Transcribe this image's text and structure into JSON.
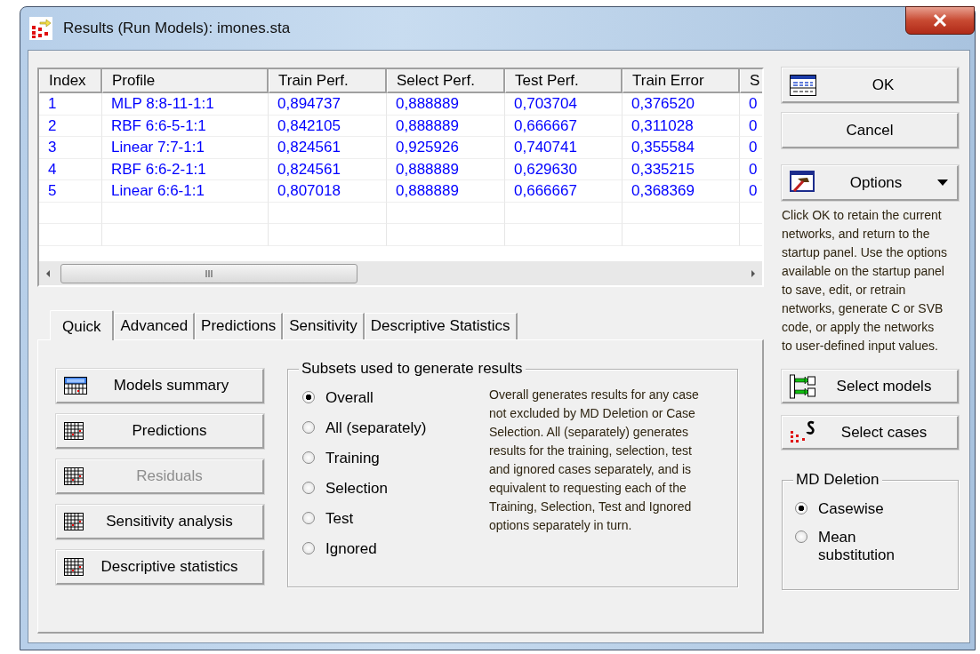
{
  "window": {
    "title": "Results (Run Models): imones.sta"
  },
  "table": {
    "columns": [
      "Index",
      "Profile",
      "Train Perf.",
      "Select Perf.",
      "Test Perf.",
      "Train Error",
      "S"
    ],
    "rows": [
      {
        "cells": [
          "1",
          "MLP 8:8-11-1:1",
          "0,894737",
          "0,888889",
          "0,703704",
          "0,376520",
          "0"
        ]
      },
      {
        "cells": [
          "2",
          "RBF 6:6-5-1:1",
          "0,842105",
          "0,888889",
          "0,666667",
          "0,311028",
          "0"
        ]
      },
      {
        "cells": [
          "3",
          "Linear 7:7-1:1",
          "0,824561",
          "0,925926",
          "0,740741",
          "0,355584",
          "0"
        ]
      },
      {
        "cells": [
          "4",
          "RBF 6:6-2-1:1",
          "0,824561",
          "0,888889",
          "0,629630",
          "0,335215",
          "0"
        ]
      },
      {
        "cells": [
          "5",
          "Linear 6:6-1:1",
          "0,807018",
          "0,888889",
          "0,666667",
          "0,368369",
          "0"
        ]
      }
    ]
  },
  "buttons": [
    {
      "label": "OK",
      "kind": "ok"
    },
    {
      "label": "Cancel",
      "kind": "plain"
    },
    {
      "label": "Options",
      "kind": "menu"
    }
  ],
  "help_text": "Click OK to retain the current networks, and return to the startup panel. Use the options available on the startup panel to save, edit, or retrain networks, generate C or SVB code, or apply the networks to user-defined input values.",
  "tabs": [
    {
      "label": "Quick",
      "selected": true
    },
    {
      "label": "Advanced",
      "selected": false
    },
    {
      "label": "Predictions",
      "selected": false
    },
    {
      "label": "Sensitivity",
      "selected": false
    },
    {
      "label": "Descriptive Statistics",
      "selected": false
    }
  ],
  "actions": [
    {
      "label": "Models summary",
      "kind": "summary",
      "disabled": false
    },
    {
      "label": "Predictions",
      "kind": "grid",
      "disabled": false
    },
    {
      "label": "Residuals",
      "kind": "grid",
      "disabled": true
    },
    {
      "label": "Sensitivity analysis",
      "kind": "grid",
      "disabled": false
    },
    {
      "label": "Descriptive statistics",
      "kind": "grid",
      "disabled": false
    }
  ],
  "subsets": {
    "title": "Subsets used to generate results",
    "options": [
      {
        "label": "Overall",
        "selected": true
      },
      {
        "label": "All (separately)",
        "selected": false
      },
      {
        "label": "Training",
        "selected": false
      },
      {
        "label": "Selection",
        "selected": false
      },
      {
        "label": "Test",
        "selected": false
      },
      {
        "label": "Ignored",
        "selected": false
      }
    ],
    "description": "Overall generates results for any case not excluded by MD Deletion or Case Selection. All (separately) generates results for the training, selection, test and ignored cases separately, and is equivalent to requesting each of the Training, Selection, Test and Ignored options separately in turn."
  },
  "side_buttons": [
    {
      "label": "Select models",
      "kind": "models"
    },
    {
      "label": "Select cases",
      "kind": "cases"
    }
  ],
  "md_deletion": {
    "title": "MD Deletion",
    "options": [
      {
        "label": "Casewise",
        "selected": true
      },
      {
        "label": "Mean substitution",
        "selected": false
      }
    ]
  }
}
